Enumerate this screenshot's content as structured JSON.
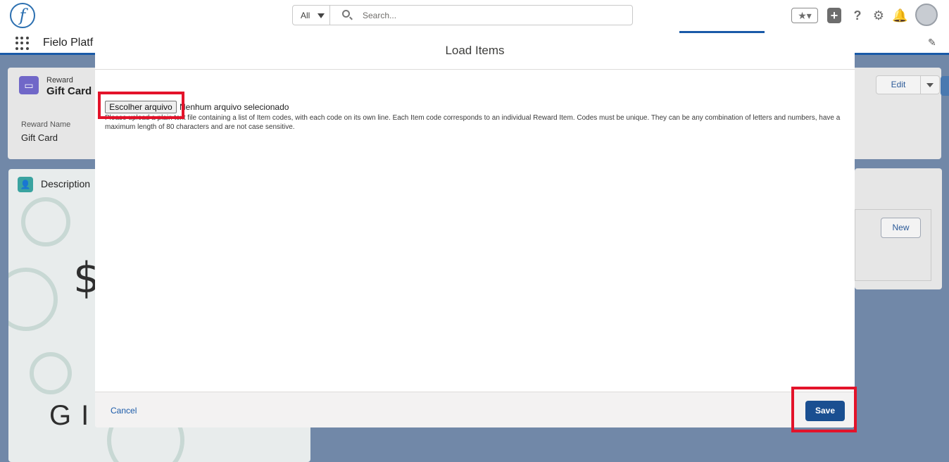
{
  "header": {
    "logo_letter": "f",
    "search_scope": "All",
    "search_placeholder": "Search..."
  },
  "nav": {
    "app_name": "Fielo Platf"
  },
  "record": {
    "type_label": "Reward",
    "name": "Gift Card",
    "field_label": "Reward Name",
    "field_value": "Gift Card",
    "edit_label": "Edit"
  },
  "description_card": {
    "title": "Description",
    "giftcard_symbol": "$",
    "giftcard_text": "GIFT CARD"
  },
  "related": {
    "new_label": "New"
  },
  "modal": {
    "title": "Load Items",
    "file_button_label": "Escolher arquivo",
    "file_status": "Nenhum arquivo selecionado",
    "instructions": "Please upload a plain text file containing a list of Item codes, with each code on its own line. Each Item code corresponds to an individual Reward Item. Codes must be unique. They can be any combination of letters and numbers, have a maximum length of 80 characters and are not case sensitive.",
    "cancel_label": "Cancel",
    "save_label": "Save"
  },
  "colors": {
    "brand_blue": "#1a4f91",
    "highlight_red": "#e3132a",
    "overlay_bg": "#7188a8"
  }
}
